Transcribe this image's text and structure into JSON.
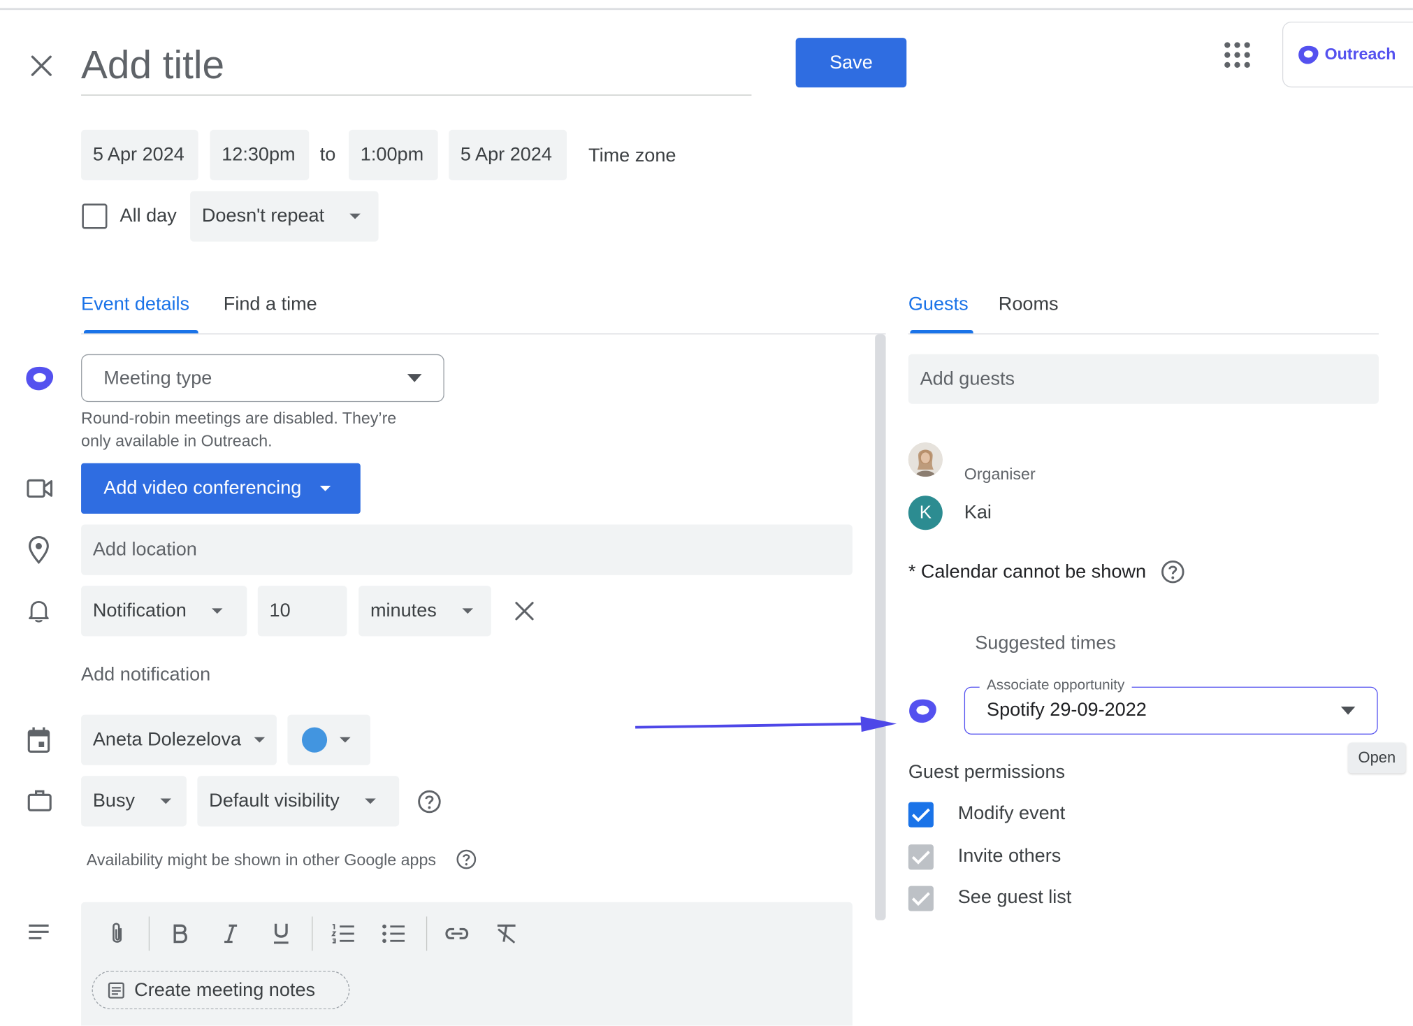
{
  "header": {
    "close_label": "close",
    "title_placeholder": "Add title",
    "save_label": "Save",
    "outreach_label": "Outreach"
  },
  "datetime": {
    "start_date": "5 Apr 2024",
    "start_time": "12:30pm",
    "to_label": "to",
    "end_time": "1:00pm",
    "end_date": "5 Apr 2024",
    "timezone_label": "Time zone",
    "all_day_label": "All day",
    "repeat_value": "Doesn't repeat"
  },
  "left_tabs": {
    "event_details": "Event details",
    "find_time": "Find a time"
  },
  "event_details": {
    "meeting_type_placeholder": "Meeting type",
    "meeting_type_hint_line1": "Round-robin meetings are disabled. They’re",
    "meeting_type_hint_line2": "only available in Outreach.",
    "video_button": "Add video conferencing",
    "location_placeholder": "Add location",
    "notification_type": "Notification",
    "notification_amount": "10",
    "notification_unit": "minutes",
    "add_notification": "Add notification",
    "calendar_owner": "Aneta Dolezelova",
    "calendar_color": "#4295e0",
    "busy_value": "Busy",
    "visibility_value": "Default visibility",
    "availability_hint": "Availability might be shown in other Google apps",
    "create_notes": "Create meeting notes"
  },
  "right_tabs": {
    "guests": "Guests",
    "rooms": "Rooms"
  },
  "guests": {
    "add_guests_placeholder": "Add guests",
    "organiser_label": "Organiser",
    "guest_initial": "K",
    "guest_name": "Kai",
    "calendar_note": "* Calendar cannot be shown",
    "suggested_times": "Suggested times",
    "associate_label": "Associate opportunity",
    "associate_value": "Spotify 29-09-2022",
    "open_tooltip": "Open",
    "permissions_title": "Guest permissions",
    "permissions": [
      {
        "label": "Modify event",
        "checked": true
      },
      {
        "label": "Invite others",
        "checked": true
      },
      {
        "label": "See guest list",
        "checked": true
      }
    ]
  },
  "colors": {
    "primary_blue": "#2f6de1",
    "tab_active": "#1a73e8",
    "outreach_purple": "#5451ef",
    "avatar_teal": "#2c8c91",
    "arrow_color": "#4e47e8"
  }
}
